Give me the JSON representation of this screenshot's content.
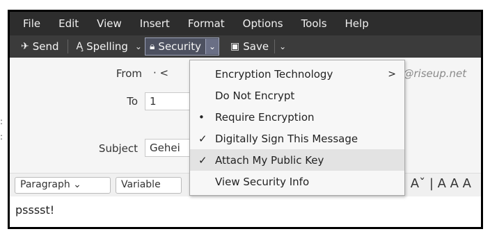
{
  "menubar": {
    "items": [
      {
        "label": "File"
      },
      {
        "label": "Edit"
      },
      {
        "label": "View"
      },
      {
        "label": "Insert"
      },
      {
        "label": "Format"
      },
      {
        "label": "Options"
      },
      {
        "label": "Tools"
      },
      {
        "label": "Help"
      }
    ]
  },
  "toolbar": {
    "send_label": "Send",
    "spelling_label": "Spelling",
    "security_label": "Security",
    "save_label": "Save"
  },
  "header": {
    "from_label": "From",
    "from_value": "· <",
    "from_right": "ia@riseup.net",
    "to_label": "To",
    "to_value": "1",
    "subject_label": "Subject",
    "subject_value": "Gehei"
  },
  "format_bar": {
    "paragraph": "Paragraph",
    "font": "Variable",
    "right_glyphs": "Aˇ | A A A"
  },
  "body": {
    "text": "psssst!"
  },
  "security_menu": {
    "items": [
      {
        "label": "Encryption Technology",
        "mark": "",
        "arrow": ">"
      },
      {
        "label": "Do Not Encrypt",
        "mark": ""
      },
      {
        "label": "Require Encryption",
        "mark": "•"
      },
      {
        "label": "Digitally Sign This Message",
        "mark": "✓"
      },
      {
        "label": "Attach My Public Key",
        "mark": "✓",
        "highlighted": true
      },
      {
        "label": "View Security Info",
        "mark": ""
      }
    ]
  },
  "colors": {
    "menubar": "#2d2d2d",
    "toolbar": "#3b3b3b",
    "highlight": "#e3e3e3"
  }
}
